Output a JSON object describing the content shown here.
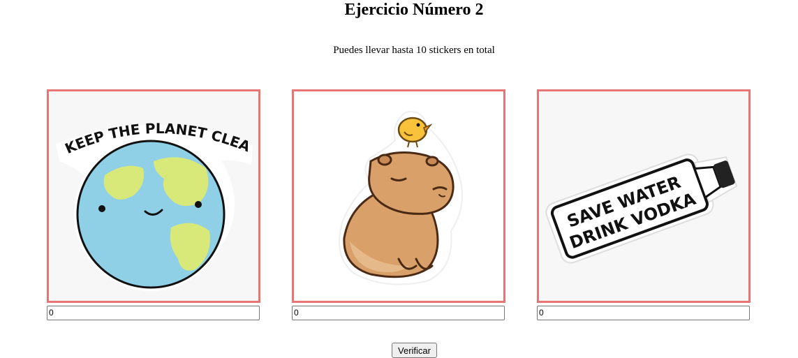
{
  "page": {
    "title": "Ejercicio Número 2",
    "subtitle": "Puedes llevar hasta 10 stickers en total"
  },
  "stickers": [
    {
      "name": "planet",
      "text": "KEEP THE PLANET CLEAN",
      "icon": "earth-sticker-icon",
      "quantity": "0"
    },
    {
      "name": "capybara",
      "text": "",
      "icon": "capybara-sticker-icon",
      "quantity": "0"
    },
    {
      "name": "vodka",
      "text_line1": "SAVE WATER",
      "text_line2": "DRINK VODKA",
      "icon": "bottle-sticker-icon",
      "quantity": "0"
    }
  ],
  "actions": {
    "verify_label": "Verificar"
  },
  "colors": {
    "frame_border": "#e87575",
    "earth_ocean": "#8fd0e6",
    "earth_land": "#d8e97a",
    "capybara_body": "#d9a06a",
    "bird": "#f9c23a"
  }
}
